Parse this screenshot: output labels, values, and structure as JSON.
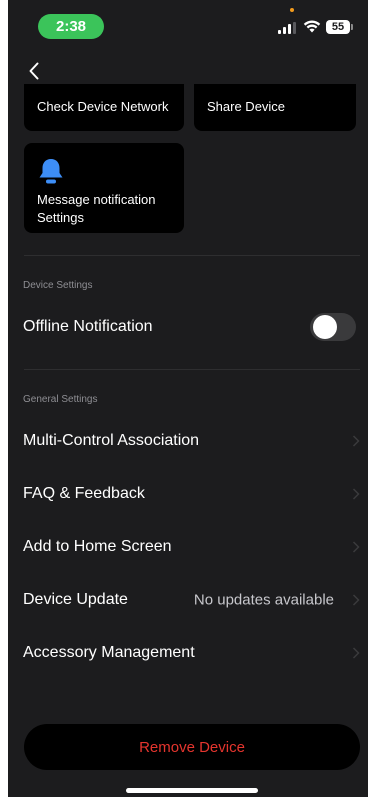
{
  "status_bar": {
    "time": "2:38",
    "battery": "55"
  },
  "tiles": [
    {
      "label": "Check Device Network"
    },
    {
      "label": "Share Device"
    },
    {
      "label_line1": "Message notification",
      "label_line2": "Settings",
      "icon": "bell-icon"
    }
  ],
  "device_settings": {
    "header": "Device Settings",
    "offline_notification": {
      "label": "Offline Notification",
      "enabled": false
    }
  },
  "general_settings": {
    "header": "General Settings",
    "items": [
      {
        "label": "Multi-Control Association",
        "value": ""
      },
      {
        "label": "FAQ & Feedback",
        "value": ""
      },
      {
        "label": "Add to Home Screen",
        "value": ""
      },
      {
        "label": "Device Update",
        "value": "No updates available"
      },
      {
        "label": "Accessory Management",
        "value": ""
      }
    ]
  },
  "remove_button": {
    "label": "Remove Device"
  },
  "colors": {
    "background": "#1c1c1e",
    "tile": "#000000",
    "accent_green": "#3bc45a",
    "danger_red": "#e5352e",
    "bell_blue": "#3d8ef7"
  }
}
